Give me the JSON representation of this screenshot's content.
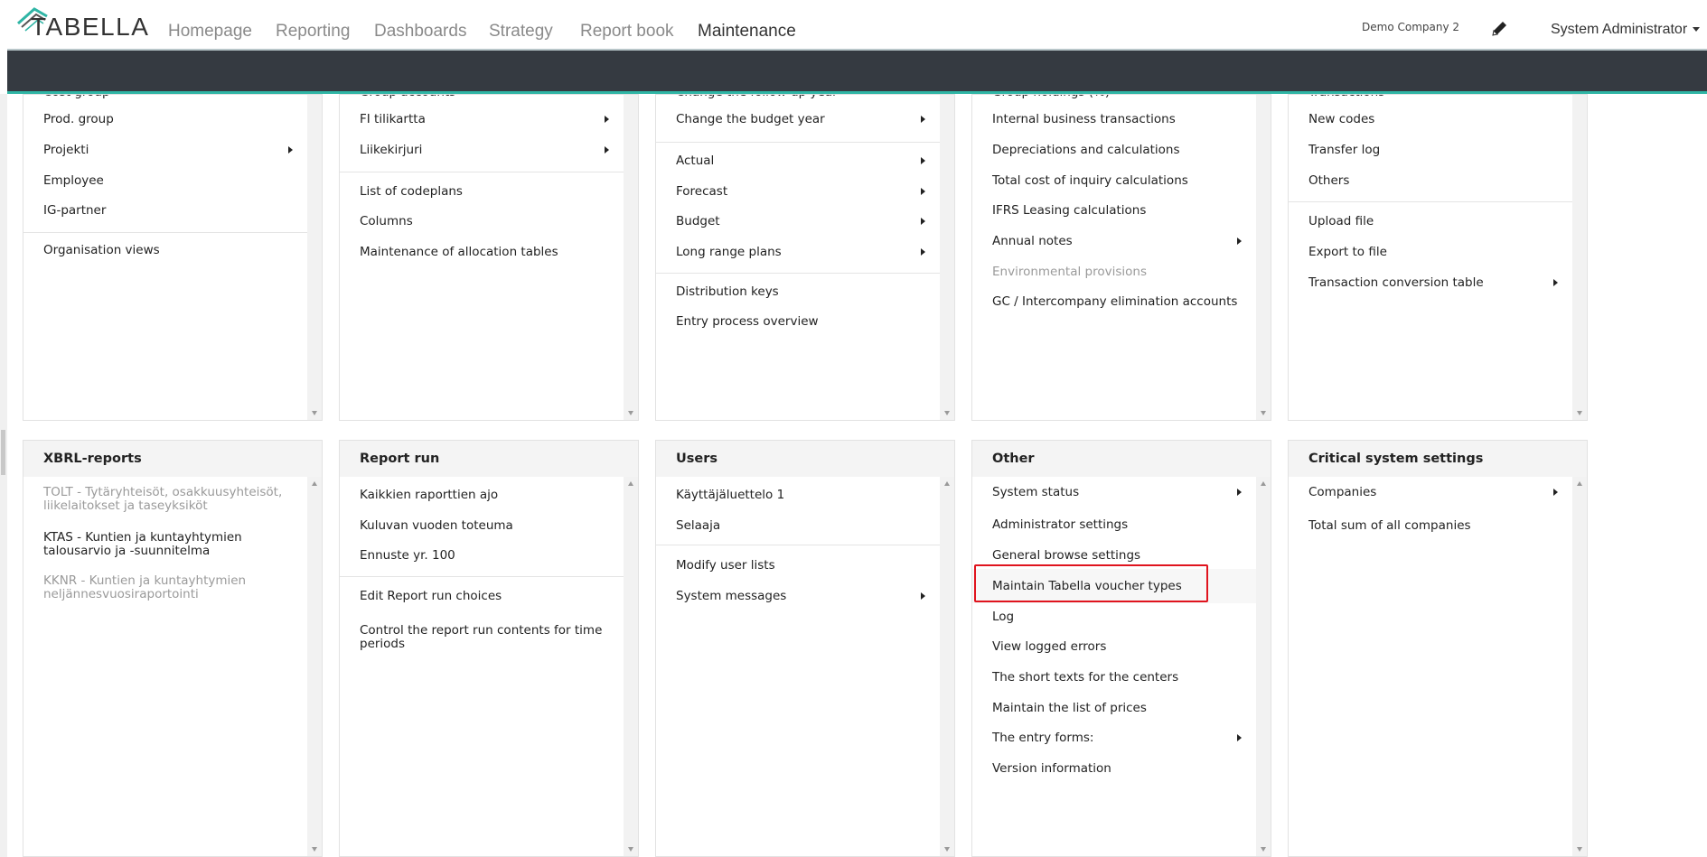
{
  "header": {
    "logo_text": "TABELLA",
    "nav": [
      "Homepage",
      "Reporting",
      "Dashboards",
      "Strategy",
      "Report book",
      "Maintenance"
    ],
    "active_nav": "Maintenance",
    "company": "Demo Company 2",
    "user": "System Administrator"
  },
  "panels": [
    {
      "title": "",
      "items": [
        {
          "label": "Cost group",
          "partial": true
        },
        {
          "label": "Prod. group"
        },
        {
          "label": "Projekti",
          "submenu": true
        },
        {
          "label": "Employee"
        },
        {
          "label": "IG-partner"
        },
        {
          "divider": true
        },
        {
          "label": "Organisation views"
        }
      ]
    },
    {
      "title": "",
      "items": [
        {
          "label": "Group accounts",
          "partial": true
        },
        {
          "label": "FI tilikartta",
          "submenu": true
        },
        {
          "label": "Liikekirjuri",
          "submenu": true
        },
        {
          "divider": true
        },
        {
          "label": "List of codeplans"
        },
        {
          "label": "Columns"
        },
        {
          "label": "Maintenance of allocation tables"
        }
      ]
    },
    {
      "title": "",
      "items": [
        {
          "label": "Change the follow-up year",
          "partial": true
        },
        {
          "label": "Change the budget year",
          "submenu": true
        },
        {
          "divider": true
        },
        {
          "label": "Actual",
          "submenu": true
        },
        {
          "label": "Forecast",
          "submenu": true
        },
        {
          "label": "Budget",
          "submenu": true
        },
        {
          "label": "Long range plans",
          "submenu": true
        },
        {
          "divider": true
        },
        {
          "label": "Distribution keys"
        },
        {
          "label": "Entry process overview"
        }
      ]
    },
    {
      "title": "",
      "items": [
        {
          "label": "Group holdings (%)",
          "partial": true
        },
        {
          "label": "Internal business transactions"
        },
        {
          "label": "Depreciations and calculations"
        },
        {
          "label": "Total cost of inquiry calculations"
        },
        {
          "label": "IFRS Leasing calculations"
        },
        {
          "label": "Annual notes",
          "submenu": true
        },
        {
          "label": "Environmental provisions",
          "disabled": true
        },
        {
          "label": "GC / Intercompany elimination accounts"
        }
      ]
    },
    {
      "title": "",
      "items": [
        {
          "label": "Transactions",
          "partial": true
        },
        {
          "label": "New codes"
        },
        {
          "label": "Transfer log"
        },
        {
          "label": "Others"
        },
        {
          "divider": true
        },
        {
          "label": "Upload file"
        },
        {
          "label": "Export to file"
        },
        {
          "label": "Transaction conversion table",
          "submenu": true
        }
      ]
    },
    {
      "title": "XBRL-reports",
      "items": [
        {
          "label": "TOLT - Tytäryhteisöt, osakkuusyhteisöt, liikelaitokset ja taseyksiköt",
          "disabled": true
        },
        {
          "label": "KTAS - Kuntien ja kuntayhtymien talousarvio ja -suunnitelma"
        },
        {
          "label": "KKNR - Kuntien ja kuntayhtymien neljännesvuosiraportointi",
          "disabled": true
        }
      ]
    },
    {
      "title": "Report run",
      "items": [
        {
          "label": "Kaikkien raporttien ajo"
        },
        {
          "label": "Kuluvan vuoden toteuma"
        },
        {
          "label": "Ennuste yr. 100"
        },
        {
          "divider": true
        },
        {
          "label": "Edit Report run choices"
        },
        {
          "label": "Control the report run contents for time periods"
        }
      ]
    },
    {
      "title": "Users",
      "items": [
        {
          "label": "Käyttäjäluettelo 1"
        },
        {
          "label": "Selaaja"
        },
        {
          "divider": true
        },
        {
          "label": "Modify user lists"
        },
        {
          "label": "System messages",
          "submenu": true
        }
      ]
    },
    {
      "title": "Other",
      "items": [
        {
          "label": "System status",
          "submenu": true
        },
        {
          "label": "Administrator settings"
        },
        {
          "label": "General browse settings"
        },
        {
          "label": "Maintain Tabella voucher types",
          "highlighted": true
        },
        {
          "label": "Log"
        },
        {
          "label": "View logged errors"
        },
        {
          "label": "The short texts for the centers"
        },
        {
          "label": "Maintain the list of prices"
        },
        {
          "label": "The entry forms:",
          "submenu": true
        },
        {
          "label": "Version information"
        }
      ]
    },
    {
      "title": "Critical system settings",
      "items": [
        {
          "label": "Companies",
          "submenu": true
        },
        {
          "label": "Total sum of all companies"
        }
      ]
    }
  ]
}
